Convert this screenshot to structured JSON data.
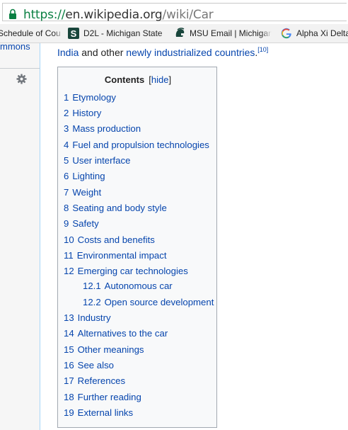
{
  "browser": {
    "url_scheme": "https://",
    "url_host": "en.wikipedia.org",
    "url_path": "/wiki/Car",
    "bookmarks": [
      {
        "label": "Schedule of Cou",
        "icon": "none"
      },
      {
        "label": "D2L - Michigan State",
        "icon": "msu-s-icon"
      },
      {
        "label": "MSU Email | Michigan",
        "icon": "spartan-helmet-icon"
      },
      {
        "label": "Alpha Xi Delta",
        "icon": "google-g-icon"
      }
    ]
  },
  "sidebar": {
    "commons_link": "mmons",
    "settings_icon": "gear-icon"
  },
  "article": {
    "lead": {
      "link1": "India",
      "text": " and other ",
      "link2": "newly industrialized countries",
      "period": ".",
      "ref": "[10]"
    },
    "toc": {
      "title": "Contents",
      "hide_open": "[",
      "hide_label": "hide",
      "hide_close": "]",
      "items": [
        {
          "num": "1",
          "label": "Etymology"
        },
        {
          "num": "2",
          "label": "History"
        },
        {
          "num": "3",
          "label": "Mass production"
        },
        {
          "num": "4",
          "label": "Fuel and propulsion technologies"
        },
        {
          "num": "5",
          "label": "User interface"
        },
        {
          "num": "6",
          "label": "Lighting"
        },
        {
          "num": "7",
          "label": "Weight"
        },
        {
          "num": "8",
          "label": "Seating and body style"
        },
        {
          "num": "9",
          "label": "Safety"
        },
        {
          "num": "10",
          "label": "Costs and benefits"
        },
        {
          "num": "11",
          "label": "Environmental impact"
        },
        {
          "num": "12",
          "label": "Emerging car technologies"
        },
        {
          "num": "12.1",
          "label": "Autonomous car"
        },
        {
          "num": "12.2",
          "label": "Open source development"
        },
        {
          "num": "13",
          "label": "Industry"
        },
        {
          "num": "14",
          "label": "Alternatives to the car"
        },
        {
          "num": "15",
          "label": "Other meanings"
        },
        {
          "num": "16",
          "label": "See also"
        },
        {
          "num": "17",
          "label": "References"
        },
        {
          "num": "18",
          "label": "Further reading"
        },
        {
          "num": "19",
          "label": "External links"
        }
      ]
    }
  }
}
